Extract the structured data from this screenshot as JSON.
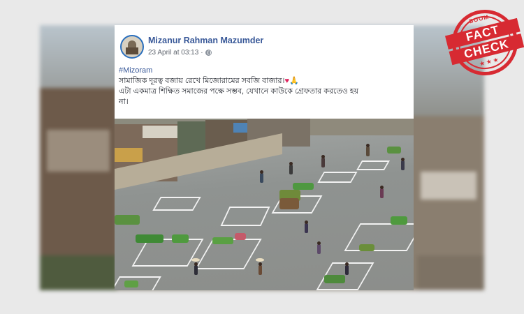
{
  "post": {
    "author": "Mizanur Rahman Mazumder",
    "timestamp": "23 April at 03:13",
    "privacy_icon": "globe-icon",
    "hashtag": "#Mizoram",
    "line1": "সামাজিক দূরত্ব বজায় রেখে মিজোরামের সবজি বাজার।",
    "line1_emojis": [
      "heart-icon",
      "pray-icon"
    ],
    "line2": "এটা একমাত্র শিক্ষিত সমাজের পক্ষে সম্ভব, যেখানে কাউকে গ্রেফতার করতেও হয়",
    "line3": "না।",
    "image_alt": "Vegetable market with vendors in painted squares"
  },
  "stamp": {
    "top": "BOOM",
    "word1": "FACT",
    "word2": "CHECK",
    "stars": "★★★",
    "color": "#d72a32"
  },
  "colors": {
    "author_link": "#385898",
    "meta_text": "#616770",
    "body_text": "#1d2129"
  }
}
